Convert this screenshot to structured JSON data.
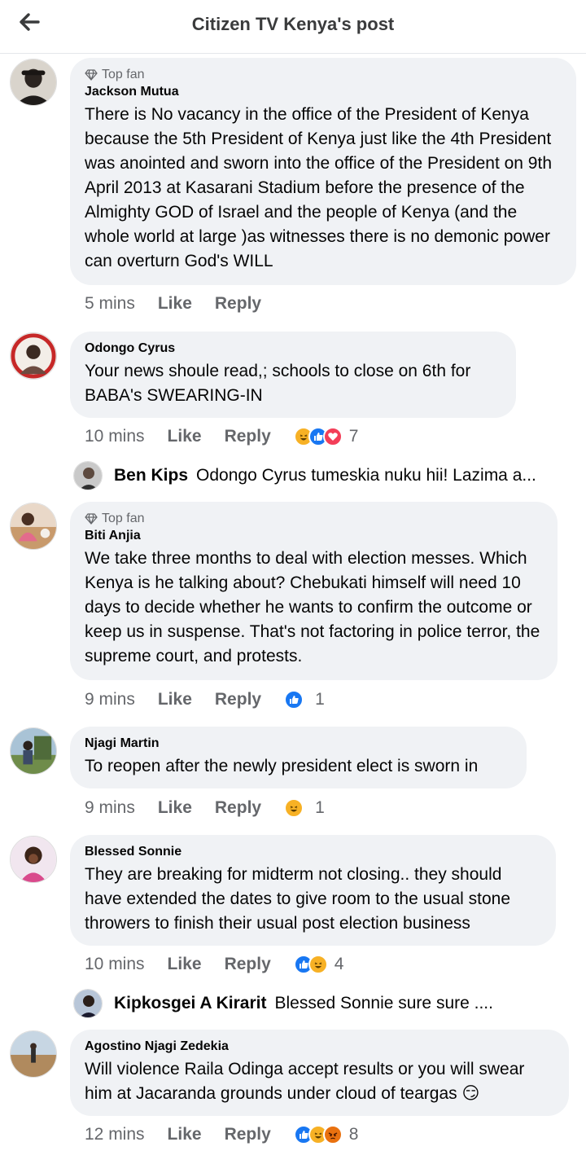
{
  "header": {
    "title": "Citizen TV Kenya's post"
  },
  "colors": {
    "like_blue": "#1877f2",
    "haha_yellow": "#f7b125",
    "love_red": "#f33e58",
    "angry_orange": "#e9710f",
    "text_secondary": "#65676b",
    "bubble_bg": "#f0f2f5"
  },
  "comments": [
    {
      "badge": "Top fan",
      "author": "Jackson Mutua",
      "text": "There is No vacancy in the office of the President of Kenya because the 5th President of Kenya just like the 4th President was anointed and sworn into the office of the President on 9th April 2013 at Kasarani Stadium before the presence of the Almighty GOD of Israel and the people of Kenya (and the whole world at large )as witnesses there is no demonic power can overturn God's WILL",
      "time": "5 mins",
      "like": "Like",
      "reply": "Reply"
    },
    {
      "author": "Odongo Cyrus",
      "text": "Your news shoule read,; schools to close on 6th for BABA's SWEARING-IN",
      "time": "10 mins",
      "like": "Like",
      "reply": "Reply",
      "reactions": [
        "haha-icon",
        "like-icon",
        "love-icon"
      ],
      "reaction_count": "7",
      "reply_preview": {
        "name": "Ben Kips",
        "text": "Odongo Cyrus tumeskia nuku hii! Lazima a..."
      }
    },
    {
      "badge": "Top fan",
      "author": "Biti Anjia",
      "text": "We take three months to deal with election messes. Which Kenya is he talking about? Chebukati himself will need 10 days to decide whether he wants to confirm the outcome or keep us in suspense. That's not factoring in police terror, the supreme court, and protests.",
      "time": "9 mins",
      "like": "Like",
      "reply": "Reply",
      "reactions": [
        "like-icon"
      ],
      "reaction_count": "1"
    },
    {
      "author": "Njagi Martin",
      "text": "To reopen after the newly president elect is sworn in",
      "time": "9 mins",
      "like": "Like",
      "reply": "Reply",
      "reactions": [
        "haha-icon"
      ],
      "reaction_count": "1"
    },
    {
      "author": "Blessed Sonnie",
      "text": "They are breaking for midterm not closing.. they should have extended the dates to give room to the usual stone throwers to finish their usual post election business",
      "time": "10 mins",
      "like": "Like",
      "reply": "Reply",
      "reactions": [
        "like-icon",
        "haha-icon"
      ],
      "reaction_count": "4",
      "reply_preview": {
        "name": "Kipkosgei A Kirarit",
        "text": "Blessed Sonnie sure sure ...."
      }
    },
    {
      "author": "Agostino Njagi Zedekia",
      "text": "Will violence Raila Odinga accept results or you will swear him at Jacaranda grounds under cloud of teargas 😏",
      "time": "12 mins",
      "like": "Like",
      "reply": "Reply",
      "reactions": [
        "like-icon",
        "haha-icon",
        "angry-icon"
      ],
      "reaction_count": "8"
    }
  ]
}
